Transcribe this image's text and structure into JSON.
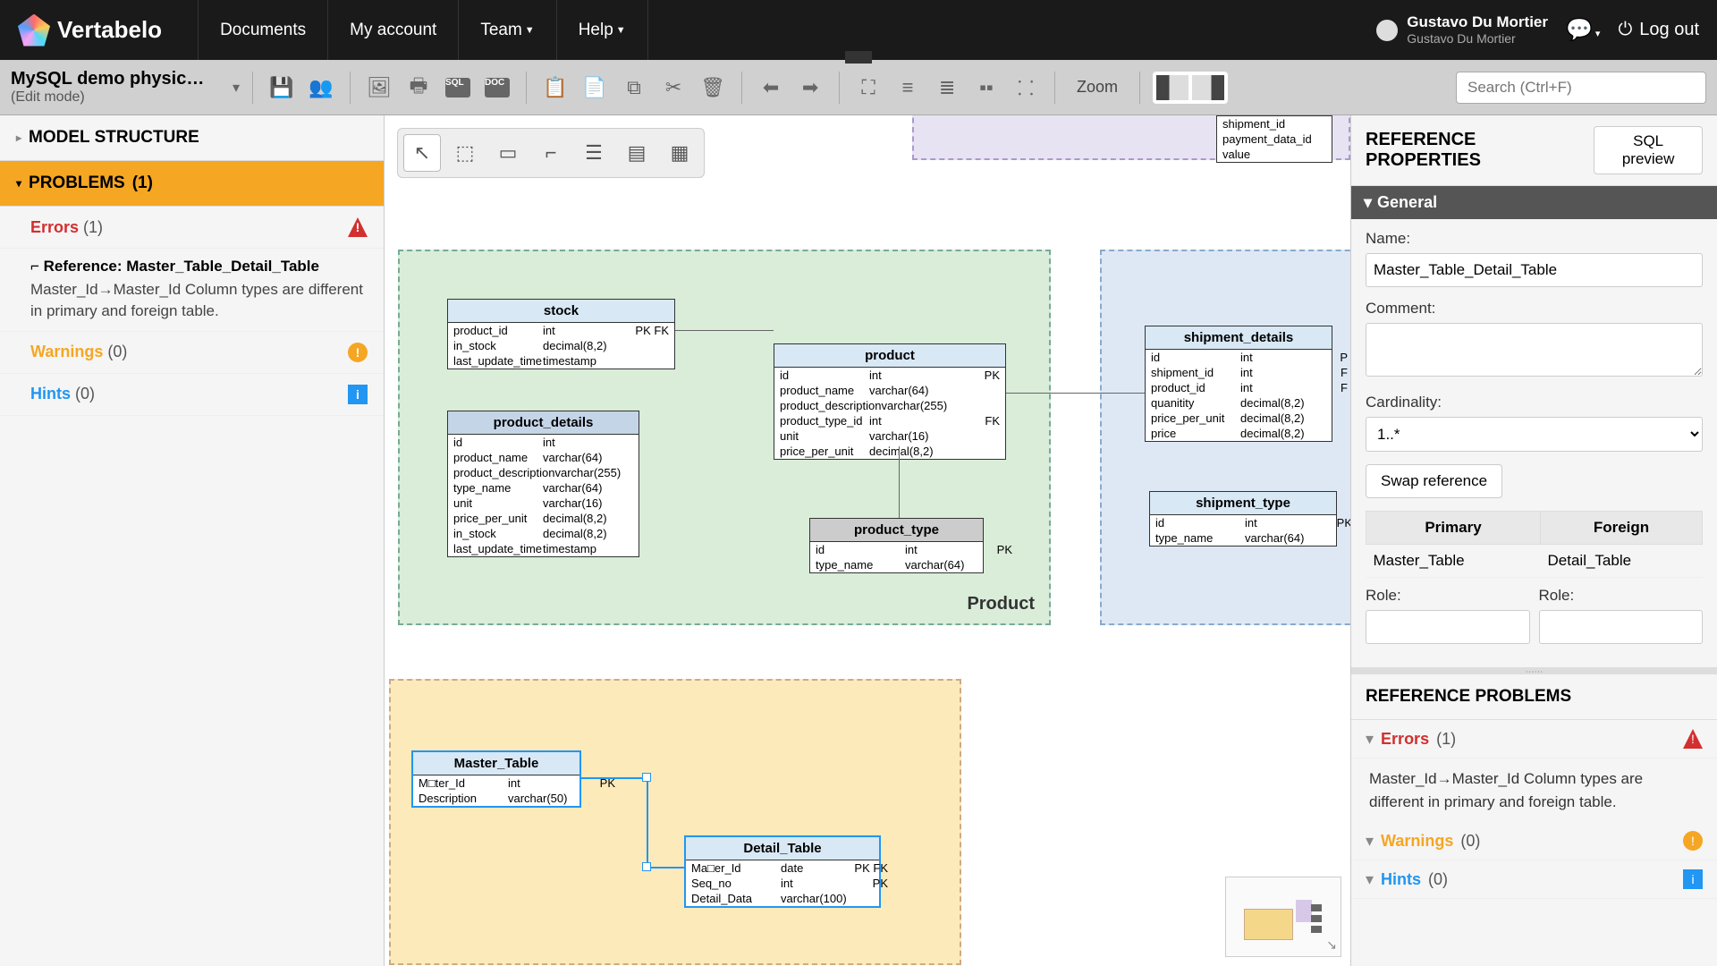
{
  "nav": {
    "logo": "Vertabelo",
    "links": [
      "Documents",
      "My account",
      "Team",
      "Help"
    ],
    "user_name": "Gustavo Du Mortier",
    "user_sub": "Gustavo Du Mortier",
    "logout": "Log out"
  },
  "toolbar": {
    "doc_title": "MySQL demo physic…",
    "doc_mode": "(Edit mode)",
    "zoom_label": "Zoom",
    "search_placeholder": "Search (Ctrl+F)"
  },
  "left": {
    "model_structure": "MODEL STRUCTURE",
    "problems": "PROBLEMS",
    "problems_count": "(1)",
    "errors": "Errors",
    "errors_count": "(1)",
    "ref_title": "Reference: Master_Table_Detail_Table",
    "ref_detail": "Master_Id→Master_Id  Column types are different in primary and foreign table.",
    "warnings": "Warnings",
    "warnings_count": "(0)",
    "hints": "Hints",
    "hints_count": "(0)"
  },
  "canvas": {
    "area_product": "Product",
    "entities": {
      "stock": {
        "name": "stock",
        "rows": [
          {
            "n": "product_id",
            "t": "int",
            "k": "PK FK"
          },
          {
            "n": "in_stock",
            "t": "decimal(8,2)",
            "k": ""
          },
          {
            "n": "last_update_time",
            "t": "timestamp",
            "k": ""
          }
        ]
      },
      "product": {
        "name": "product",
        "rows": [
          {
            "n": "id",
            "t": "int",
            "k": "PK"
          },
          {
            "n": "product_name",
            "t": "varchar(64)",
            "k": ""
          },
          {
            "n": "product_description",
            "t": "varchar(255)",
            "k": ""
          },
          {
            "n": "product_type_id",
            "t": "int",
            "k": "FK"
          },
          {
            "n": "unit",
            "t": "varchar(16)",
            "k": ""
          },
          {
            "n": "price_per_unit",
            "t": "decimal(8,2)",
            "k": ""
          }
        ]
      },
      "product_details": {
        "name": "product_details",
        "rows": [
          {
            "n": "id",
            "t": "int",
            "k": ""
          },
          {
            "n": "product_name",
            "t": "varchar(64)",
            "k": ""
          },
          {
            "n": "product_description",
            "t": "varchar(255)",
            "k": ""
          },
          {
            "n": "type_name",
            "t": "varchar(64)",
            "k": ""
          },
          {
            "n": "unit",
            "t": "varchar(16)",
            "k": ""
          },
          {
            "n": "price_per_unit",
            "t": "decimal(8,2)",
            "k": ""
          },
          {
            "n": "in_stock",
            "t": "decimal(8,2)",
            "k": ""
          },
          {
            "n": "last_update_time",
            "t": "timestamp",
            "k": ""
          }
        ]
      },
      "product_type": {
        "name": "product_type",
        "rows": [
          {
            "n": "id",
            "t": "int",
            "k": "PK"
          },
          {
            "n": "type_name",
            "t": "varchar(64)",
            "k": ""
          }
        ]
      },
      "shipment_details": {
        "name": "shipment_details",
        "rows": [
          {
            "n": "id",
            "t": "int",
            "k": "P"
          },
          {
            "n": "shipment_id",
            "t": "int",
            "k": "F"
          },
          {
            "n": "product_id",
            "t": "int",
            "k": "F"
          },
          {
            "n": "quanitity",
            "t": "decimal(8,2)",
            "k": ""
          },
          {
            "n": "price_per_unit",
            "t": "decimal(8,2)",
            "k": ""
          },
          {
            "n": "price",
            "t": "decimal(8,2)",
            "k": ""
          }
        ]
      },
      "shipment_type": {
        "name": "shipment_type",
        "rows": [
          {
            "n": "id",
            "t": "int",
            "k": "PK"
          },
          {
            "n": "type_name",
            "t": "varchar(64)",
            "k": ""
          }
        ]
      },
      "master_table": {
        "name": "Master_Table",
        "rows": [
          {
            "n": "M□ter_Id",
            "t": "int",
            "k": "PK"
          },
          {
            "n": "Description",
            "t": "varchar(50)",
            "k": ""
          }
        ]
      },
      "detail_table": {
        "name": "Detail_Table",
        "rows": [
          {
            "n": "Ma□er_Id",
            "t": "date",
            "k": "PK FK"
          },
          {
            "n": "Seq_no",
            "t": "int",
            "k": "PK"
          },
          {
            "n": "Detail_Data",
            "t": "varchar(100)",
            "k": ""
          }
        ]
      },
      "partial": {
        "rows": [
          "shipment_id",
          "payment_data_id",
          "value"
        ]
      }
    }
  },
  "right": {
    "title": "REFERENCE PROPERTIES",
    "sql_preview": "SQL preview",
    "general": "General",
    "name_label": "Name:",
    "name_value": "Master_Table_Detail_Table",
    "comment_label": "Comment:",
    "cardinality_label": "Cardinality:",
    "cardinality_value": "1..*",
    "swap": "Swap reference",
    "primary_h": "Primary",
    "foreign_h": "Foreign",
    "primary_v": "Master_Table",
    "foreign_v": "Detail_Table",
    "role_label": "Role:",
    "problems_title": "REFERENCE PROBLEMS",
    "errors": "Errors",
    "errors_count": "(1)",
    "err_detail": "Master_Id→Master_Id  Column types are different in primary and foreign table.",
    "warnings": "Warnings",
    "warnings_count": "(0)",
    "hints": "Hints",
    "hints_count": "(0)"
  }
}
